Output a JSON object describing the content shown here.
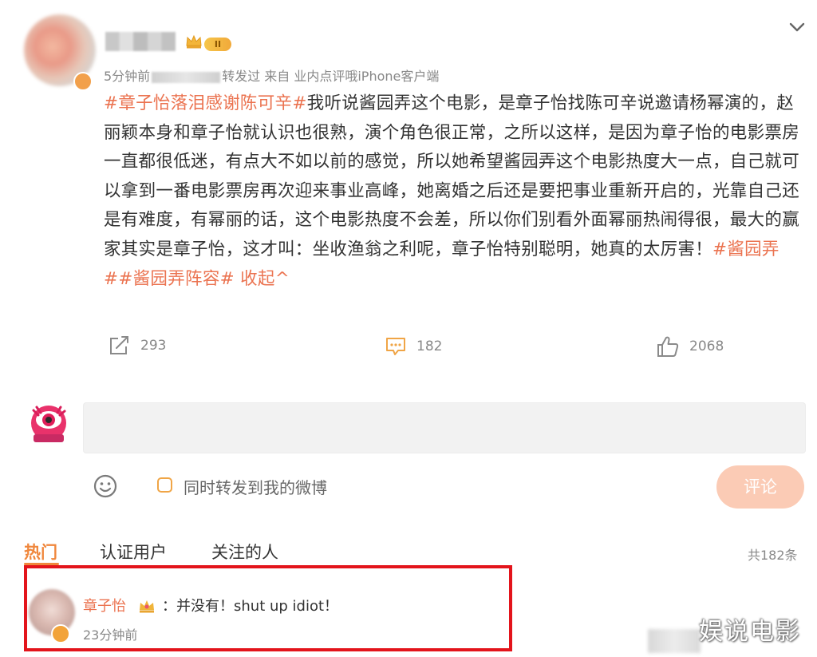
{
  "post": {
    "meta": "5分钟前",
    "meta_suffix": "转发过  来自 业内点评哦iPhone客户端",
    "level_badge": "II",
    "body": [
      {
        "t": "#章子怡落泪感谢陈可辛#",
        "hl": true
      },
      {
        "t": "我听说酱园弄这个电影，是章子怡找陈可辛说邀请杨幂演的，赵丽颖本身和章子怡就认识也很熟，演个角色很正常，之所以这样，是因为章子怡的电影票房一直都很低迷，有点大不如以前的感觉，所以她希望酱园弄这个电影热度大一点，自己就可以拿到一番电影票房再次迎来事业高峰，她离婚之后还是要把事业重新开启的，光靠自己还是有难度，有幂丽的话，这个电影热度不会差，所以你们别看外面幂丽热闹得很，最大的赢家其实是章子怡，这才叫：坐收渔翁之利呢，章子怡特别聪明，她真的太厉害！",
        "hl": false
      },
      {
        "t": "#酱园弄##酱园弄阵容#",
        "hl": true
      },
      {
        "t": " 收起^",
        "hl": true
      }
    ]
  },
  "actions": {
    "repost_count": "293",
    "comment_count": "182",
    "like_count": "2068"
  },
  "compose": {
    "placeholder": "",
    "repost_label": "同时转发到我的微博",
    "submit_label": "评论"
  },
  "tabs": {
    "hot": "热门",
    "verified": "认证用户",
    "following": "关注的人",
    "total": "共182条"
  },
  "comment": {
    "author": "章子怡",
    "text": "：并没有！shut up idiot！",
    "time": "23分钟前"
  },
  "watermark": "娱说电影",
  "colors": {
    "accent": "#eb7350",
    "red_frame": "#e3141b",
    "button_bg": "#fbcbb5"
  }
}
